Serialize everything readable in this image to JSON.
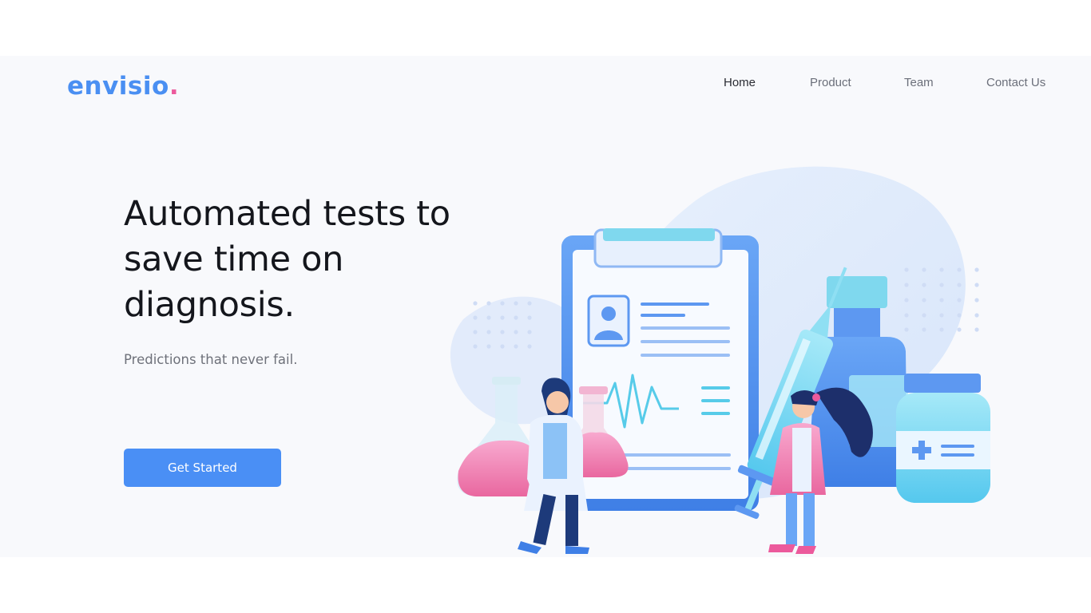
{
  "brand": {
    "name": "envisio",
    "dot": "."
  },
  "nav": {
    "items": [
      {
        "label": "Home",
        "active": true
      },
      {
        "label": "Product",
        "active": false
      },
      {
        "label": "Team",
        "active": false
      },
      {
        "label": "Contact Us",
        "active": false
      }
    ]
  },
  "hero": {
    "title": "Automated tests to save time on diagnosis.",
    "subtitle": "Predictions that never fail.",
    "cta_label": "Get Started"
  },
  "colors": {
    "brand": "#4a8ff2",
    "accent_pink": "#ec5a9c",
    "button": "#4a8ff5",
    "background_band": "#f8f9fc"
  },
  "illustration": {
    "icon": "medical-lab-illustration"
  }
}
